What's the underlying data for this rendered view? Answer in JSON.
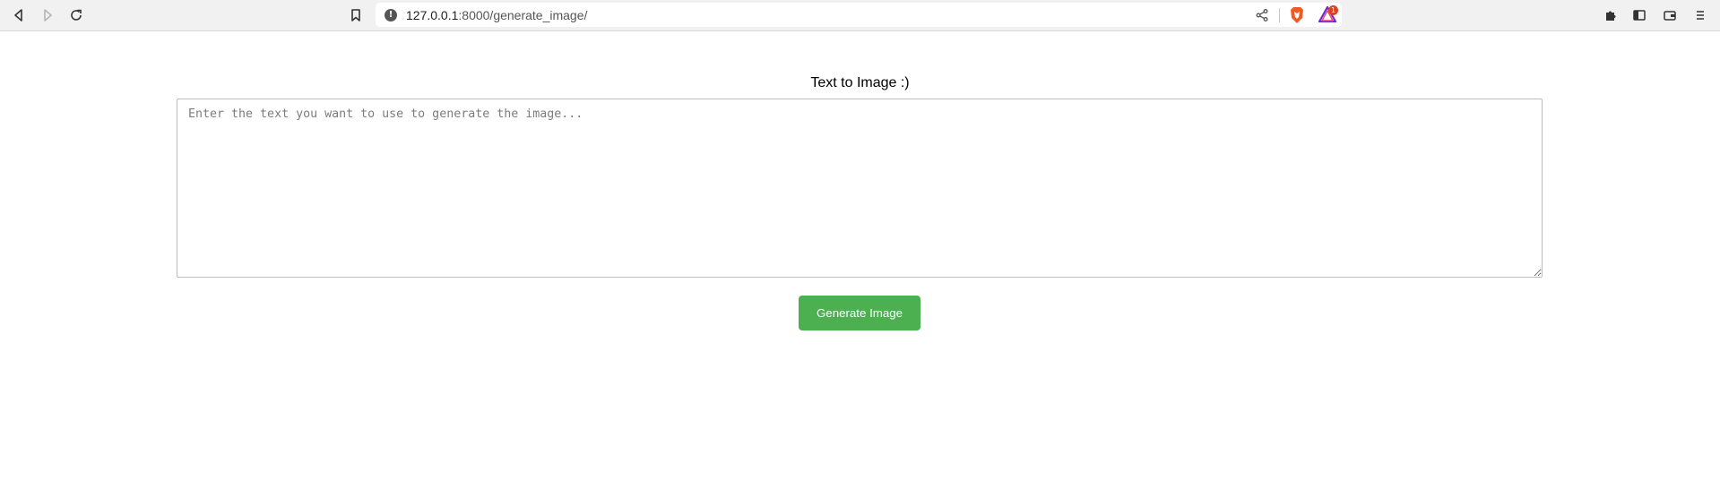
{
  "browser": {
    "url_host": "127.0.0.1",
    "url_path": ":8000/generate_image/",
    "rewards_badge": "1",
    "icons": {
      "back": "back-arrow-icon",
      "forward": "forward-arrow-icon",
      "reload": "reload-icon",
      "bookmark": "bookmark-icon",
      "site_info": "site-info-icon",
      "share": "share-icon",
      "brave_shields": "brave-shields-icon",
      "rewards": "brave-rewards-icon",
      "extensions": "extensions-icon",
      "sidebar": "sidebar-icon",
      "wallet": "wallet-icon",
      "menu": "menu-icon"
    }
  },
  "page": {
    "title": "Text to Image :)",
    "prompt_placeholder": "Enter the text you want to use to generate the image...",
    "prompt_value": "",
    "generate_button_label": "Generate Image"
  },
  "colors": {
    "button_bg": "#4caf50",
    "button_text": "#ffffff",
    "toolbar_bg": "#f1f1f1"
  }
}
